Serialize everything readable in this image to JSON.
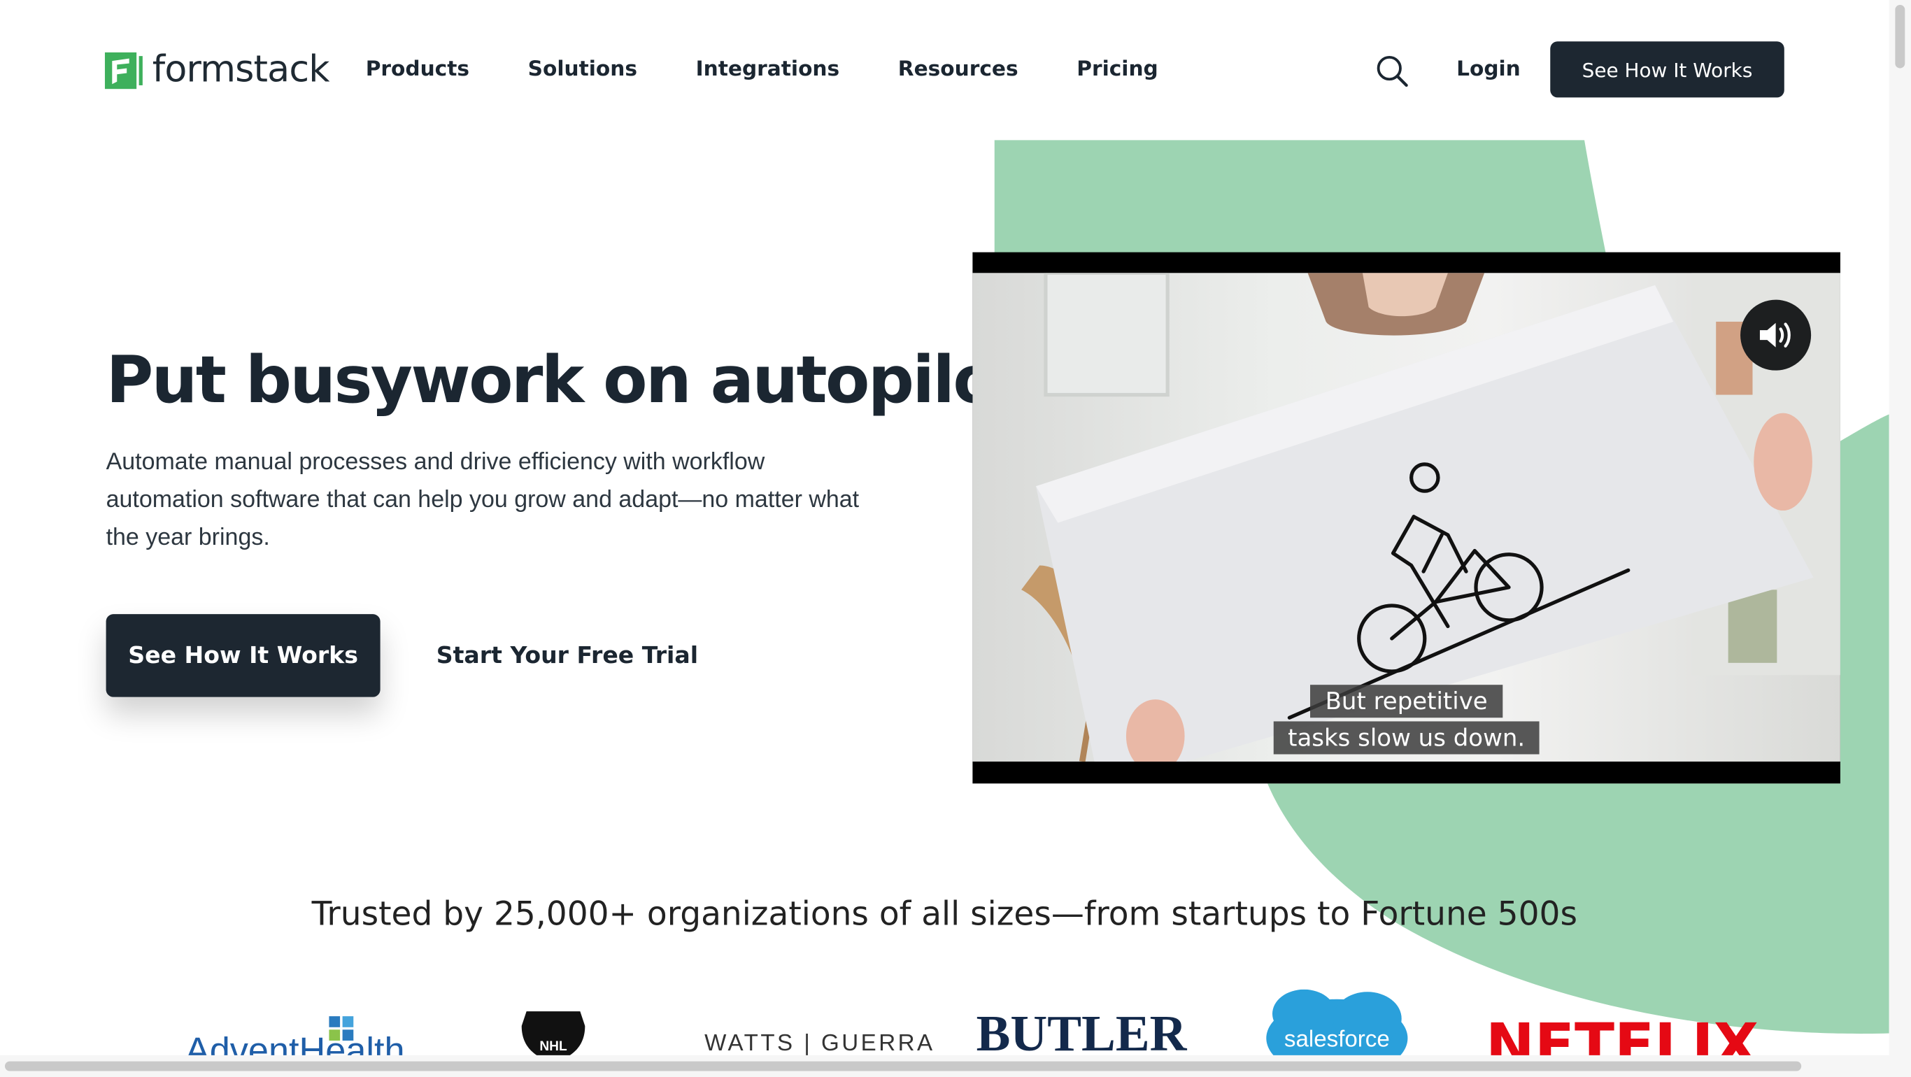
{
  "brand": {
    "name": "formstack",
    "colors": {
      "green": "#3eb05c",
      "dark": "#1d2731",
      "accent_bg": "#9dd4b2"
    }
  },
  "nav": {
    "items": [
      "Products",
      "Solutions",
      "Integrations",
      "Resources",
      "Pricing"
    ],
    "search_icon": "search-icon",
    "login": "Login",
    "cta": "See How It Works"
  },
  "hero": {
    "title": "Put busywork on autopilot",
    "subtitle": "Automate manual processes and drive efficiency with workflow automation software that can help you grow and adapt—no matter what the year brings.",
    "primary_cta": "See How It Works",
    "secondary_cta": "Start Your Free Trial"
  },
  "video": {
    "caption_line1": "But repetitive",
    "caption_line2": "tasks slow us down.",
    "volume_icon": "volume-icon"
  },
  "trust": {
    "heading": "Trusted by 25,000+ organizations of all sizes—from startups to Fortune 500s",
    "logos": [
      "AdventHealth",
      "NHL",
      "WATTS | GUERRA",
      "BUTLER",
      "salesforce",
      "NETFLIX"
    ]
  }
}
